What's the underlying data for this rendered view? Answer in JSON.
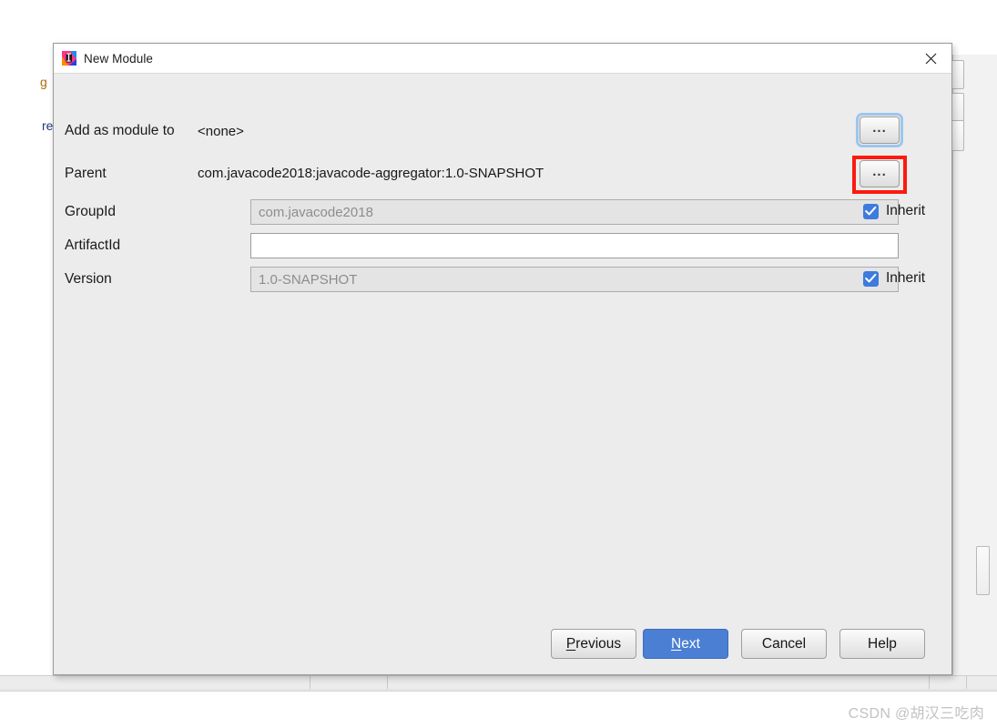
{
  "window": {
    "title": "New Module",
    "icon": "intellij-idea-icon",
    "close_icon": "close-icon"
  },
  "form": {
    "add_as_module_to": {
      "label": "Add as module to",
      "value": "<none>",
      "browse_label": "...",
      "browse_icon": "ellipsis-icon",
      "focused": true
    },
    "parent": {
      "label": "Parent",
      "value": "com.javacode2018:javacode-aggregator:1.0-SNAPSHOT",
      "browse_label": "...",
      "browse_icon": "ellipsis-icon",
      "highlighted": true
    },
    "group_id": {
      "label": "GroupId",
      "value": "com.javacode2018",
      "inherit_label": "Inherit",
      "inherit_checked": true,
      "disabled": true
    },
    "artifact_id": {
      "label": "ArtifactId",
      "value": "",
      "disabled": false
    },
    "version": {
      "label": "Version",
      "value": "1.0-SNAPSHOT",
      "inherit_label": "Inherit",
      "inherit_checked": true,
      "disabled": true
    }
  },
  "footer": {
    "previous": {
      "prefix": "",
      "mnemonic": "P",
      "suffix": "revious"
    },
    "next": {
      "prefix": "",
      "mnemonic": "N",
      "suffix": "ext"
    },
    "cancel": "Cancel",
    "help": "Help"
  },
  "background": {
    "clipped_text_top": "g",
    "clipped_text_mid": "re"
  },
  "watermark": "CSDN @胡汉三吃肉",
  "colors": {
    "accent_blue": "#4a7fd4",
    "checkbox_blue": "#3d7bdd",
    "highlight_red": "#fb1a10",
    "focus_ring": "#9cc6ef",
    "dialog_bg": "#ececec"
  }
}
